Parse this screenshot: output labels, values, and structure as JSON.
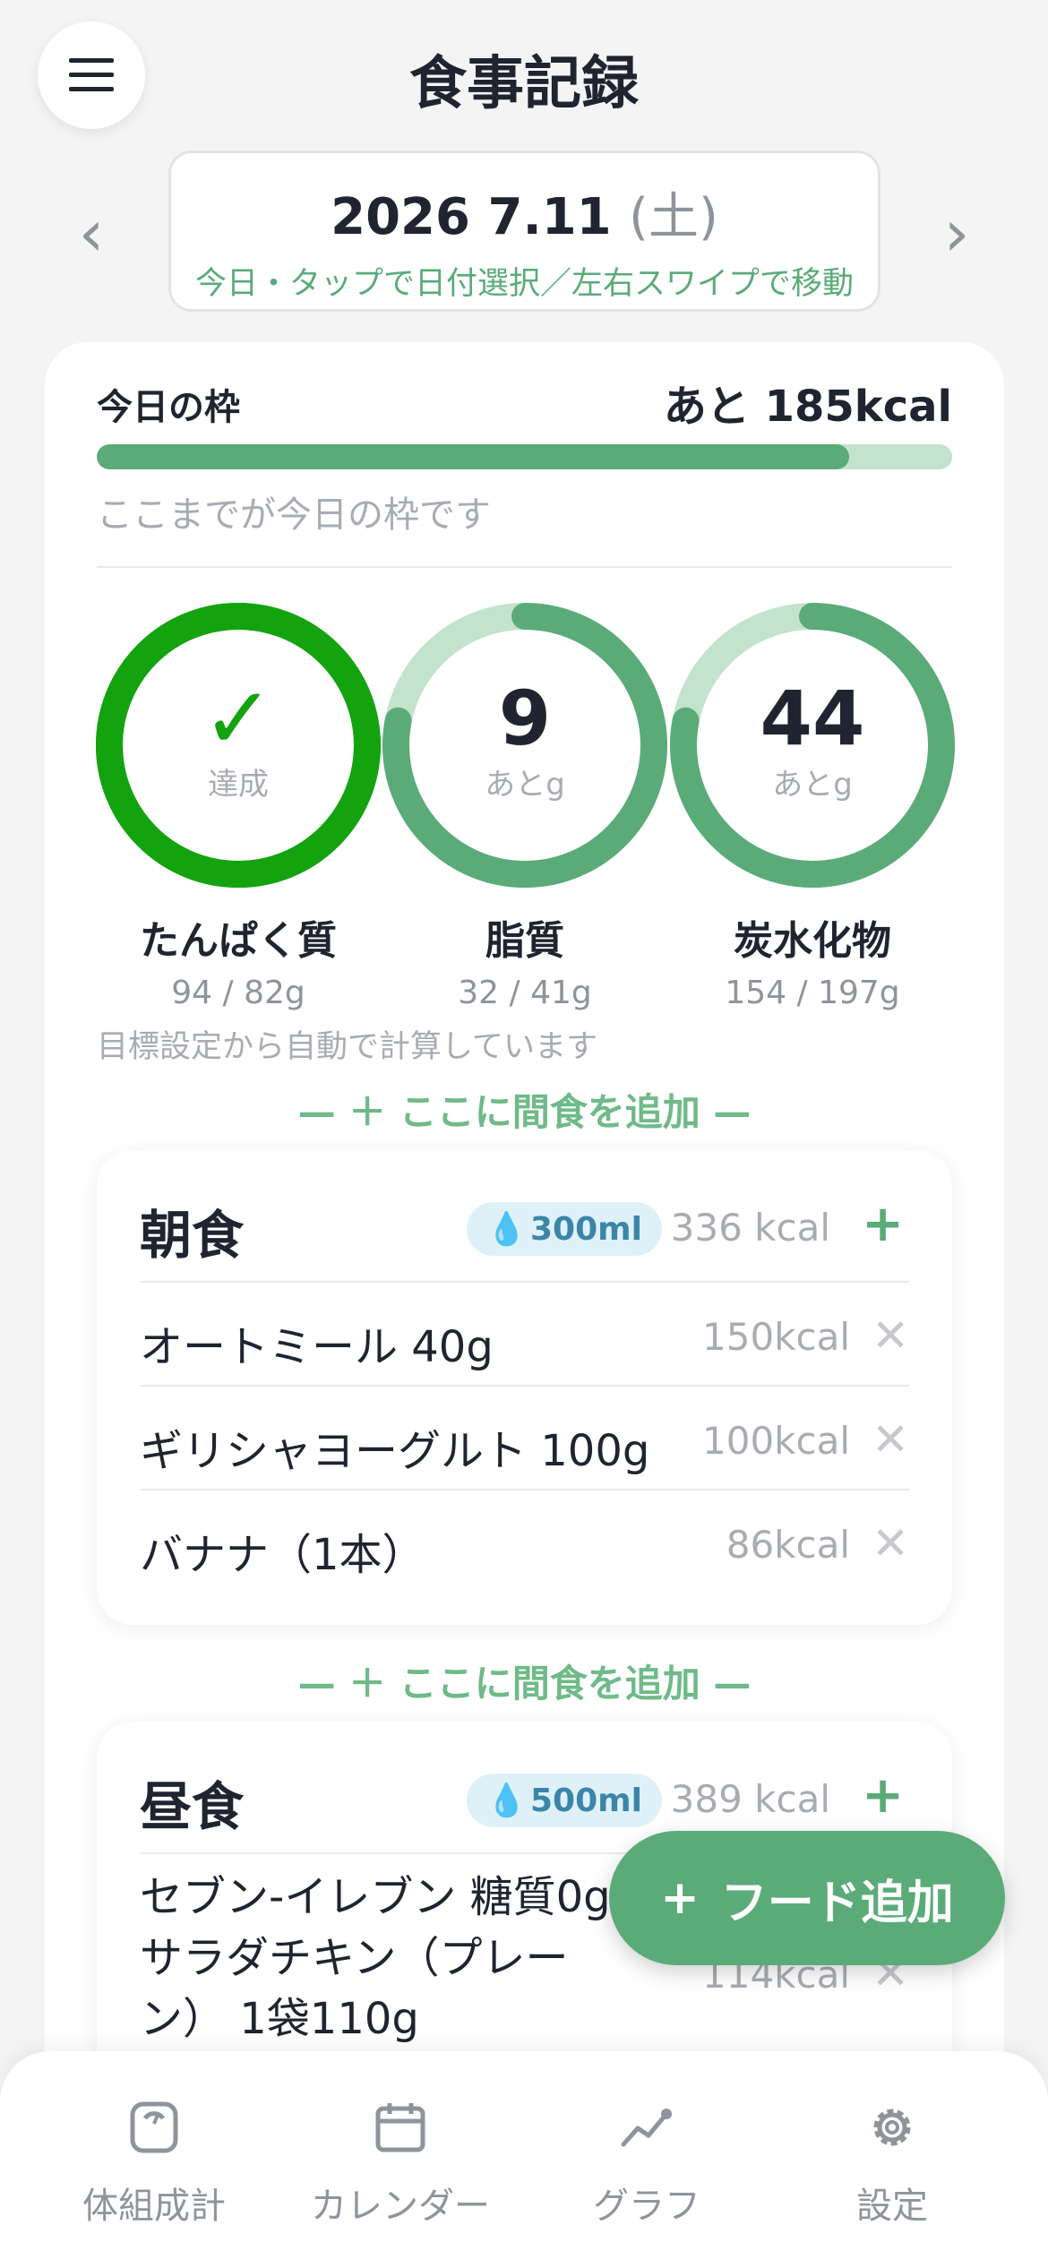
{
  "header": {
    "title": "食事記録",
    "menu_icon": "hamburger-icon",
    "prev_arrow": "‹",
    "next_arrow": "›"
  },
  "date": {
    "main": "2026 7.11",
    "dow": "(土)",
    "hint": "今日・タップで日付選択／左右スワイプで移動"
  },
  "budget": {
    "title": "今日の枠",
    "remaining": "あと 185kcal",
    "progress": 0.88,
    "note": "ここまでが今日の枠です"
  },
  "macros": [
    {
      "name": "たんぱく質",
      "value": "✓",
      "unit": "達成",
      "amount": "94 / 82g",
      "progress": 1.0,
      "color": "#13a30f",
      "track": "#13a30f"
    },
    {
      "name": "脂質",
      "value": "9",
      "unit": "あとg",
      "amount": "32 / 41g",
      "progress": 0.78,
      "color": "#5aab78",
      "track": "#c3e3cc"
    },
    {
      "name": "炭水化物",
      "value": "44",
      "unit": "あとg",
      "amount": "154 / 197g",
      "progress": 0.78,
      "color": "#5aab78",
      "track": "#c3e3cc"
    }
  ],
  "auto_note": "目標設定から自動で計算しています",
  "snack_add_label": "— ＋ ここに間食を追加 —",
  "meals": {
    "breakfast": {
      "name": "朝食",
      "water": "300ml",
      "kcal": "336 kcal",
      "add": "+",
      "items": [
        {
          "name": "オートミール 40g",
          "kcal": "150kcal"
        },
        {
          "name": "ギリシャヨーグルト 100g",
          "kcal": "100kcal"
        },
        {
          "name": "バナナ（1本）",
          "kcal": "86kcal"
        }
      ]
    },
    "lunch": {
      "name": "昼食",
      "water": "500ml",
      "kcal": "389 kcal",
      "add": "+",
      "items": [
        {
          "name": "セブン-イレブン 糖質0g サラダチキン（プレーン） 1袋110g",
          "kcal": "114kcal"
        }
      ]
    }
  },
  "delete_glyph": "✕",
  "water_icon": "💧",
  "fab": {
    "plus": "+",
    "label": "フード追加"
  },
  "tabs": [
    {
      "label": "体組成計",
      "icon": "scale-icon"
    },
    {
      "label": "カレンダー",
      "icon": "calendar-icon"
    },
    {
      "label": "グラフ",
      "icon": "chart-icon"
    },
    {
      "label": "設定",
      "icon": "gear-icon"
    }
  ],
  "colors": {
    "accent": "#5aab78",
    "accent_light": "#c3e3cc",
    "achieved": "#13a30f",
    "water_bg": "#dff1f8",
    "water_text": "#3b86a8"
  }
}
